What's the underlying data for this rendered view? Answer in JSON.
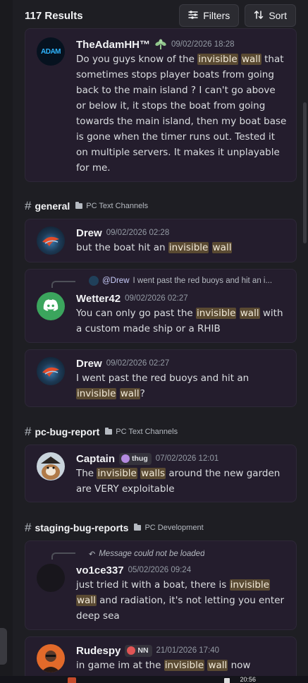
{
  "header": {
    "results_count": "117 Results",
    "filters_label": "Filters",
    "sort_label": "Sort",
    "filters_icon": "sliders-icon",
    "sort_icon": "sort-arrows-icon"
  },
  "search_term_highlight_color": "#5a4a32",
  "groups": [
    {
      "messages": [
        {
          "author": "TheAdamHH™",
          "author_icon": "server-tag-plant-icon",
          "timestamp": "09/02/2026 18:28",
          "avatar_text": "ADAM",
          "segments": [
            {
              "t": "Do you guys know of the "
            },
            {
              "t": "invisible",
              "hl": true
            },
            {
              "t": " "
            },
            {
              "t": "wall",
              "hl": true
            },
            {
              "t": " that sometimes stops player boats from going back to the main island ? I can't go above or below it, it stops the boat from going towards the main island, then my boat base is gone when the timer runs out. Tested it on multiple servers. It makes it unplayable for me."
            }
          ]
        }
      ]
    },
    {
      "channel": "general",
      "category": "PC Text Channels",
      "messages": [
        {
          "author": "Drew",
          "timestamp": "09/02/2026 02:28",
          "segments": [
            {
              "t": "but the boat hit an "
            },
            {
              "t": "invisible",
              "hl": true
            },
            {
              "t": " "
            },
            {
              "t": "wall",
              "hl": true
            }
          ]
        },
        {
          "reply_to": "@Drew",
          "reply_text": "I went past the red buoys and hit an i...",
          "author": "Wetter42",
          "timestamp": "09/02/2026 02:27",
          "segments": [
            {
              "t": "You can only go past the "
            },
            {
              "t": "invisible",
              "hl": true
            },
            {
              "t": " "
            },
            {
              "t": "wall",
              "hl": true
            },
            {
              "t": " with a custom made ship or a RHIB"
            }
          ]
        },
        {
          "author": "Drew",
          "timestamp": "09/02/2026 02:27",
          "segments": [
            {
              "t": "I went past the red buoys and hit an "
            },
            {
              "t": "invisible",
              "hl": true
            },
            {
              "t": " "
            },
            {
              "t": "wall",
              "hl": true
            },
            {
              "t": "?"
            }
          ]
        }
      ]
    },
    {
      "channel": "pc-bug-report",
      "category": "PC Text Channels",
      "messages": [
        {
          "author": "Captain",
          "tag": "thug",
          "timestamp": "07/02/2026 12:01",
          "segments": [
            {
              "t": "The "
            },
            {
              "t": "invisible",
              "hl": true
            },
            {
              "t": " "
            },
            {
              "t": "walls",
              "hl": true
            },
            {
              "t": " around the new garden are VERY exploitable"
            }
          ]
        }
      ]
    },
    {
      "channel": "staging-bug-reports",
      "category": "PC Development",
      "messages": [
        {
          "reply_text": "Message could not be loaded",
          "author": "vo1ce337",
          "timestamp": "05/02/2026 09:24",
          "segments": [
            {
              "t": "just tried it with a boat, there is "
            },
            {
              "t": "invisible",
              "hl": true
            },
            {
              "t": " "
            },
            {
              "t": "wall",
              "hl": true
            },
            {
              "t": " and radiation, it's not letting you enter deep sea"
            }
          ]
        },
        {
          "author": "Rudespy",
          "tag": "NN",
          "timestamp": "21/01/2026 17:40",
          "segments": [
            {
              "t": "in game im at the "
            },
            {
              "t": "invisible",
              "hl": true
            },
            {
              "t": " "
            },
            {
              "t": "wall",
              "hl": true
            },
            {
              "t": " now"
            }
          ]
        }
      ]
    }
  ],
  "taskbar": {
    "clock": "20:56"
  }
}
